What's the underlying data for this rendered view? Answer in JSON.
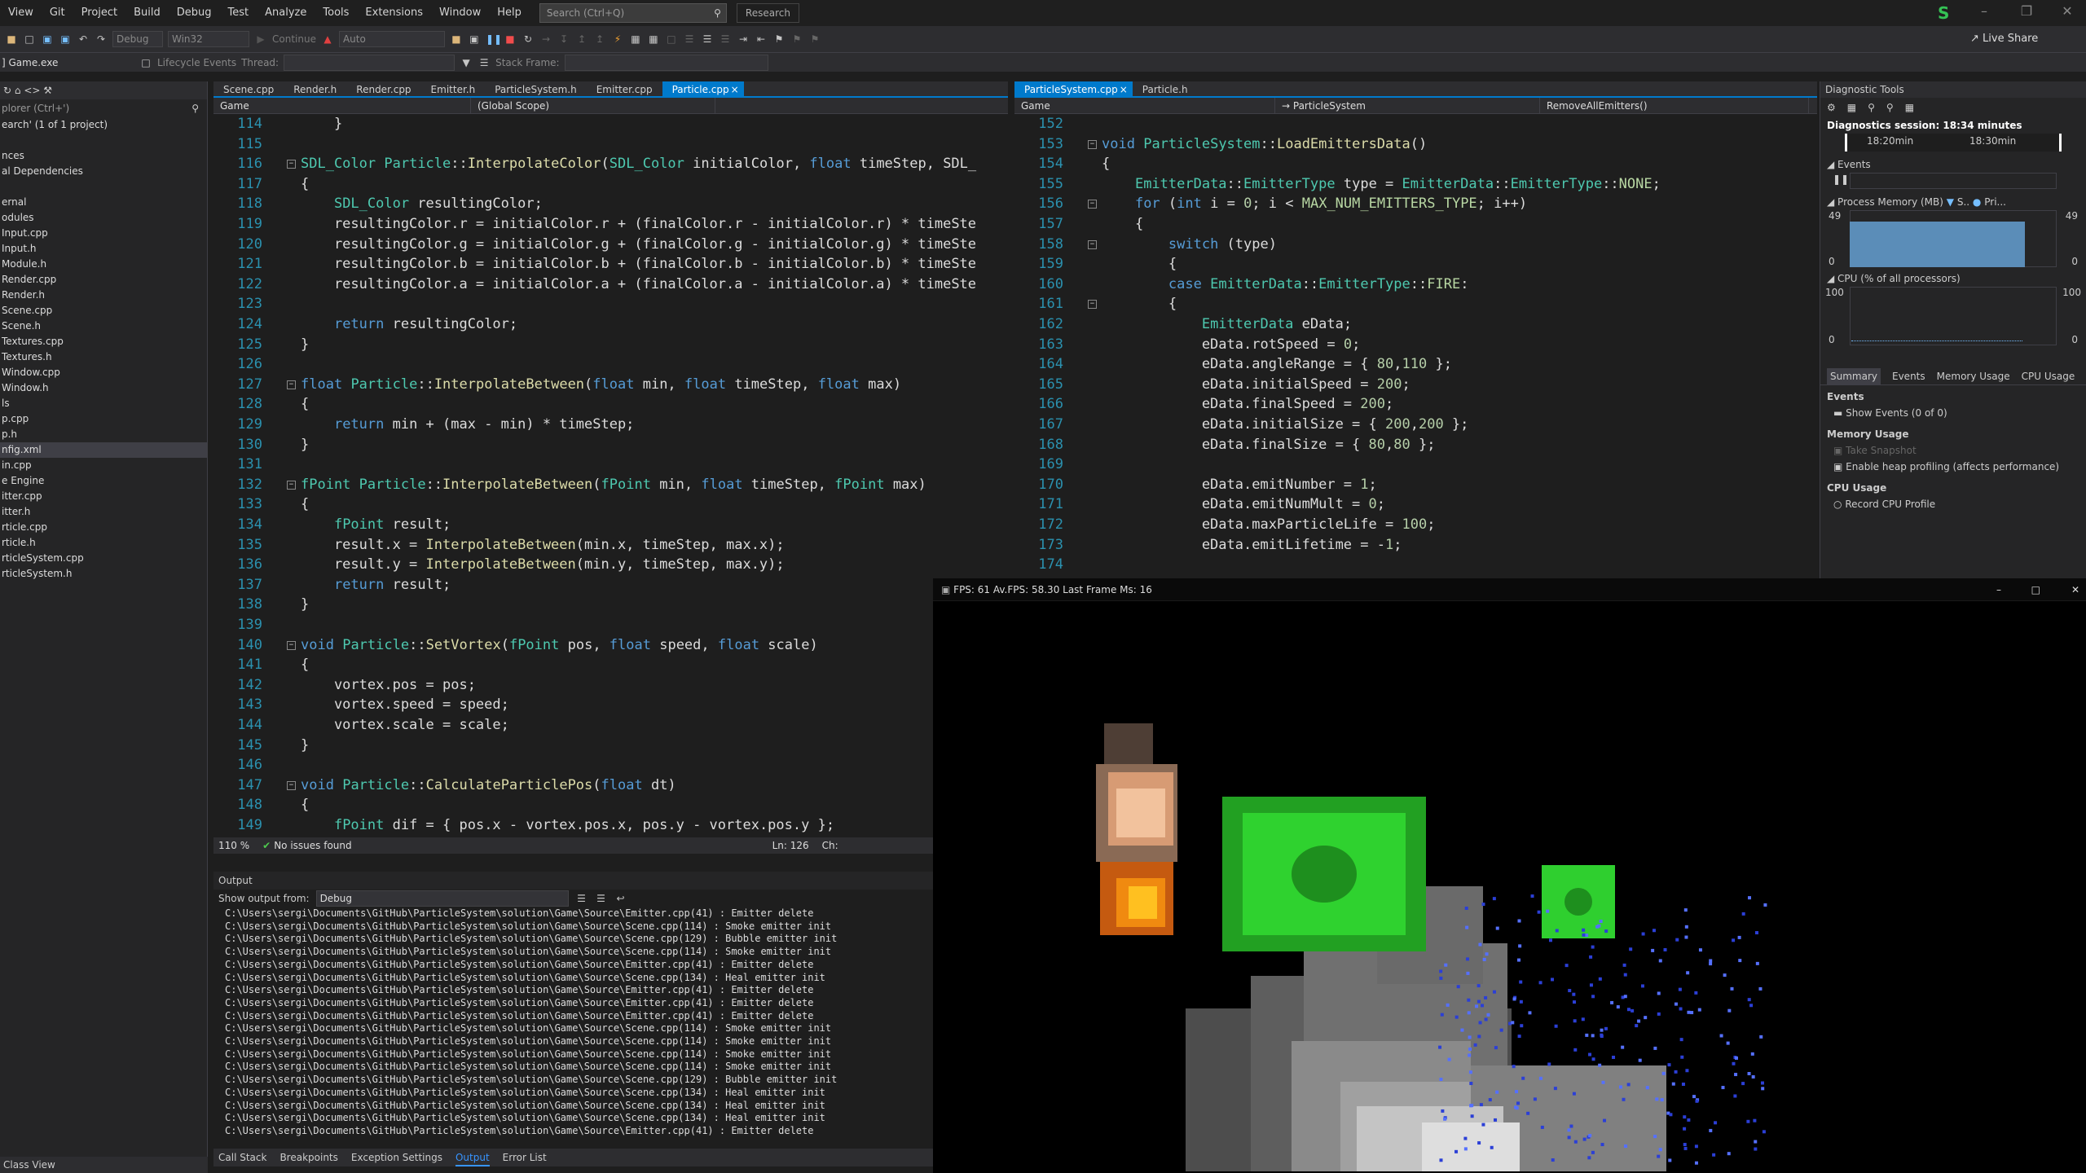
{
  "menu": [
    "View",
    "Git",
    "Project",
    "Build",
    "Debug",
    "Test",
    "Analyze",
    "Tools",
    "Extensions",
    "Window",
    "Help"
  ],
  "search": {
    "placeholder": "Search (Ctrl+Q)"
  },
  "research": "Research",
  "user_initial": "S",
  "liveshare": "Live Share",
  "toolbar": {
    "config": "Debug",
    "platform": "Win32",
    "continue": "Continue",
    "auto": "Auto",
    "lifecycle": "Lifecycle Events",
    "thread": "Thread:",
    "stackframe": "Stack Frame:",
    "process": "] Game.exe"
  },
  "solution_explorer": {
    "search_placeholder": "plorer (Ctrl+')",
    "items": [
      "earch' (1 of 1 project)",
      "",
      "nces",
      "al Dependencies",
      "",
      "ernal",
      "odules",
      "Input.cpp",
      "Input.h",
      "Module.h",
      "Render.cpp",
      "Render.h",
      "Scene.cpp",
      "Scene.h",
      "Textures.cpp",
      "Textures.h",
      "Window.cpp",
      "Window.h",
      "ls",
      "p.cpp",
      "p.h",
      "nfig.xml",
      "in.cpp",
      "e Engine",
      "itter.cpp",
      "itter.h",
      "rticle.cpp",
      "rticle.h",
      "rticleSystem.cpp",
      "rticleSystem.h"
    ],
    "selected_index": 21,
    "class_view": "Class View"
  },
  "left_editor": {
    "tabs": [
      "Scene.cpp",
      "Render.h",
      "Render.cpp",
      "Emitter.h",
      "ParticleSystem.h",
      "Emitter.cpp",
      "Particle.cpp"
    ],
    "active_tab": 6,
    "nav": [
      "Game",
      "(Global Scope)"
    ],
    "zoom": "110 %",
    "issues": "No issues found",
    "ln": "Ln: 126",
    "ch": "Ch:"
  },
  "right_editor": {
    "tabs": [
      "ParticleSystem.cpp",
      "Particle.h"
    ],
    "active_tab": 0,
    "nav": [
      "Game",
      "→ ParticleSystem",
      "RemoveAllEmitters()"
    ]
  },
  "output": {
    "title": "Output",
    "show_from": "Show output from:",
    "source": "Debug",
    "lines": [
      "C:\\Users\\sergi\\Documents\\GitHub\\ParticleSystem\\solution\\Game\\Source\\Emitter.cpp(41) : Emitter delete",
      "C:\\Users\\sergi\\Documents\\GitHub\\ParticleSystem\\solution\\Game\\Source\\Scene.cpp(114) : Smoke emitter init",
      "C:\\Users\\sergi\\Documents\\GitHub\\ParticleSystem\\solution\\Game\\Source\\Scene.cpp(129) : Bubble emitter init",
      "C:\\Users\\sergi\\Documents\\GitHub\\ParticleSystem\\solution\\Game\\Source\\Scene.cpp(114) : Smoke emitter init",
      "C:\\Users\\sergi\\Documents\\GitHub\\ParticleSystem\\solution\\Game\\Source\\Emitter.cpp(41) : Emitter delete",
      "C:\\Users\\sergi\\Documents\\GitHub\\ParticleSystem\\solution\\Game\\Source\\Scene.cpp(134) : Heal emitter init",
      "C:\\Users\\sergi\\Documents\\GitHub\\ParticleSystem\\solution\\Game\\Source\\Emitter.cpp(41) : Emitter delete",
      "C:\\Users\\sergi\\Documents\\GitHub\\ParticleSystem\\solution\\Game\\Source\\Emitter.cpp(41) : Emitter delete",
      "C:\\Users\\sergi\\Documents\\GitHub\\ParticleSystem\\solution\\Game\\Source\\Emitter.cpp(41) : Emitter delete",
      "C:\\Users\\sergi\\Documents\\GitHub\\ParticleSystem\\solution\\Game\\Source\\Scene.cpp(114) : Smoke emitter init",
      "C:\\Users\\sergi\\Documents\\GitHub\\ParticleSystem\\solution\\Game\\Source\\Scene.cpp(114) : Smoke emitter init",
      "C:\\Users\\sergi\\Documents\\GitHub\\ParticleSystem\\solution\\Game\\Source\\Scene.cpp(114) : Smoke emitter init",
      "C:\\Users\\sergi\\Documents\\GitHub\\ParticleSystem\\solution\\Game\\Source\\Scene.cpp(114) : Smoke emitter init",
      "C:\\Users\\sergi\\Documents\\GitHub\\ParticleSystem\\solution\\Game\\Source\\Scene.cpp(129) : Bubble emitter init",
      "C:\\Users\\sergi\\Documents\\GitHub\\ParticleSystem\\solution\\Game\\Source\\Scene.cpp(134) : Heal emitter init",
      "C:\\Users\\sergi\\Documents\\GitHub\\ParticleSystem\\solution\\Game\\Source\\Scene.cpp(134) : Heal emitter init",
      "C:\\Users\\sergi\\Documents\\GitHub\\ParticleSystem\\solution\\Game\\Source\\Scene.cpp(134) : Heal emitter init",
      "C:\\Users\\sergi\\Documents\\GitHub\\ParticleSystem\\solution\\Game\\Source\\Emitter.cpp(41) : Emitter delete"
    ]
  },
  "bottom_tabs": [
    "Call Stack",
    "Breakpoints",
    "Exception Settings",
    "Output",
    "Error List"
  ],
  "bottom_active": 3,
  "diag": {
    "title": "Diagnostic Tools",
    "session": "Diagnostics session: 18:34 minutes",
    "t1": "18:20min",
    "t2": "18:30min",
    "events": "Events",
    "process_memory": "Process Memory (MB)",
    "pm_legend1": "S..",
    "pm_legend2": "Pri...",
    "mem_max": "49",
    "mem_min": "0",
    "cpu": "CPU (% of all processors)",
    "cpu_max": "100",
    "cpu_min": "0",
    "tabs": [
      "Summary",
      "Events",
      "Memory Usage",
      "CPU Usage"
    ],
    "events_hdr": "Events",
    "show_events": "Show Events (0 of 0)",
    "memory_hdr": "Memory Usage",
    "take_snapshot": "Take Snapshot",
    "heap": "Enable heap profiling (affects performance)",
    "cpu_hdr": "CPU Usage",
    "record_cpu": "Record CPU Profile"
  },
  "game_window": {
    "title": "FPS: 61 Av.FPS: 58.30 Last Frame Ms: 16"
  }
}
